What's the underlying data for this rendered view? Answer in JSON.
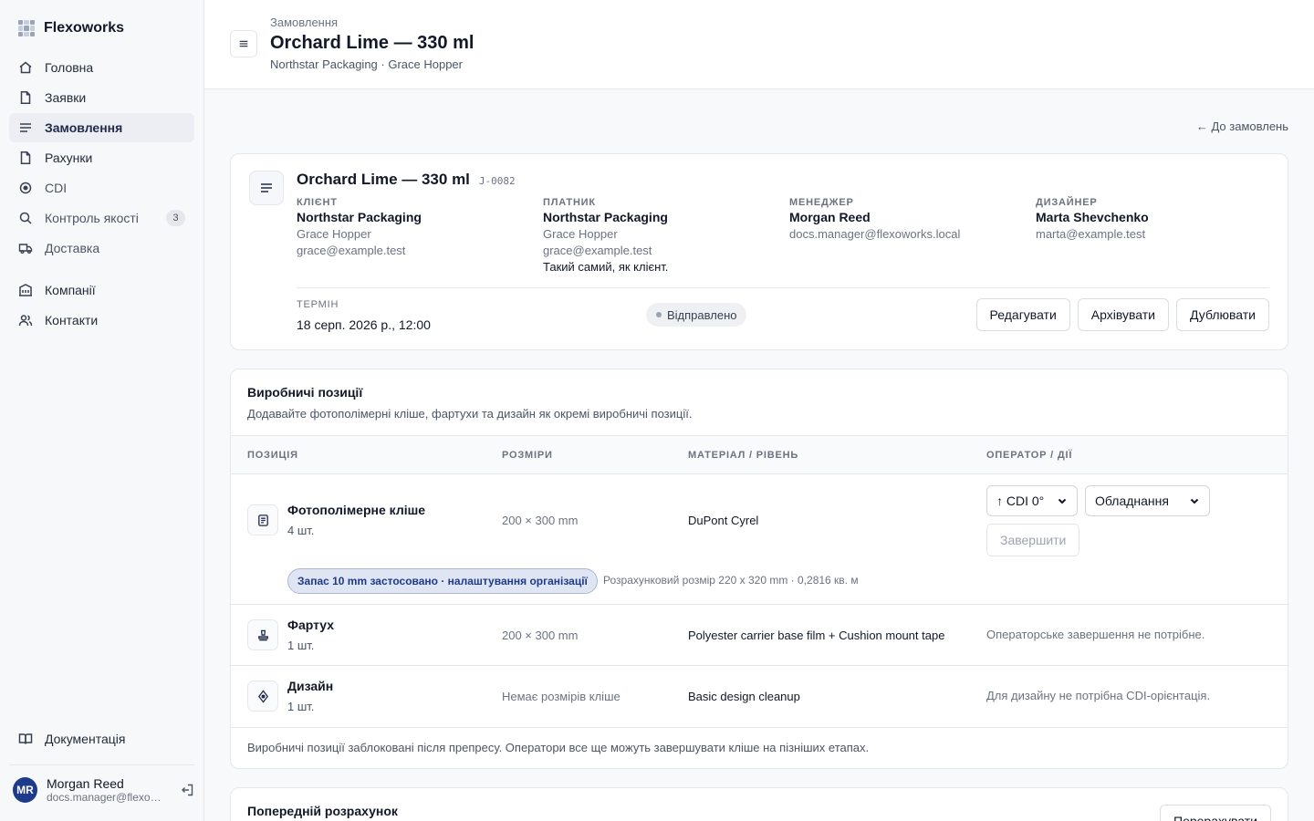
{
  "sidebar": {
    "brand": "Flexoworks",
    "items": [
      {
        "label": "Головна",
        "icon": "home-icon"
      },
      {
        "label": "Заявки",
        "icon": "file-icon"
      },
      {
        "label": "Замовлення",
        "icon": "list-icon",
        "active": true
      },
      {
        "label": "Рахунки",
        "icon": "file-icon"
      },
      {
        "label": "CDI",
        "icon": "target-icon"
      },
      {
        "label": "Контроль якості",
        "icon": "search-icon",
        "badge": "3"
      },
      {
        "label": "Доставка",
        "icon": "truck-icon"
      }
    ],
    "items2": [
      {
        "label": "Компанії",
        "icon": "building-icon"
      },
      {
        "label": "Контакти",
        "icon": "users-icon"
      }
    ],
    "docs": "Документація",
    "user": {
      "initials": "MR",
      "name": "Morgan Reed",
      "email": "docs.manager@flexoworks.local"
    }
  },
  "header": {
    "crumb": "Замовлення",
    "title": "Orchard Lime — 330 ml",
    "subtitle": "Northstar Packaging · Grace Hopper"
  },
  "main": {
    "back_link": "← До замовлень",
    "job": {
      "title": "Orchard Lime — 330 ml",
      "code": "J-0082",
      "client": {
        "label": "Клієнт",
        "name": "Northstar Packaging",
        "contact": "Grace Hopper",
        "email": "grace@example.test"
      },
      "payer": {
        "label": "Платник",
        "name": "Northstar Packaging",
        "contact": "Grace Hopper",
        "email": "grace@example.test",
        "note": "Такий самий, як клієнт."
      },
      "manager": {
        "label": "Менеджер",
        "name": "Morgan Reed",
        "email": "docs.manager@flexoworks.local"
      },
      "designer": {
        "label": "Дизайнер",
        "name": "Marta Shevchenko",
        "email": "marta@example.test"
      },
      "term_label": "ТЕРМІН",
      "term_value": "18 серп. 2026 р., 12:00",
      "status": "Відправлено",
      "buttons": {
        "edit": "Редагувати",
        "archive": "Архівувати",
        "duplicate": "Дублювати"
      }
    },
    "production": {
      "title": "Виробничі позиції",
      "description": "Додавайте фотополімерні кліше, фартухи та дизайн як окремі виробничі позиції.",
      "columns": [
        "ПОЗИЦІЯ",
        "РОЗМІРИ",
        "МАТЕРІАЛ / РІВЕНЬ",
        "ОПЕРАТОР / ДІЇ"
      ],
      "rows": [
        {
          "name": "Фотополімерне кліше",
          "qty": "4 шт.",
          "dims": "200 × 300 mm",
          "material": "DuPont Cyrel",
          "cdi_select": "↑ CDI 0°",
          "equip_select": "Обладнання",
          "complete": "Завершити",
          "margin_chip": "Запас 10 mm застосовано · налаштування організації",
          "calc": "Розрахунковий розмір 220 x 320 mm · 0,2816 кв. м"
        },
        {
          "name": "Фартух",
          "qty": "1 шт.",
          "dims": "200 × 300 mm",
          "material": "Polyester carrier base film + Cushion mount tape",
          "operator": "Операторське завершення не потрібне."
        },
        {
          "name": "Дизайн",
          "qty": "1 шт.",
          "dims": "Немає розмірів кліше",
          "material": "Basic design cleanup",
          "operator": "Для дизайну не потрібна CDI-орієнтація."
        }
      ],
      "footnote": "Виробничі позиції заблоковані після препресу. Оператори все ще можуть завершувати кліше на пізніших етапах."
    },
    "estimate": {
      "title": "Попередній розрахунок",
      "recalc": "Перерахувати"
    }
  }
}
